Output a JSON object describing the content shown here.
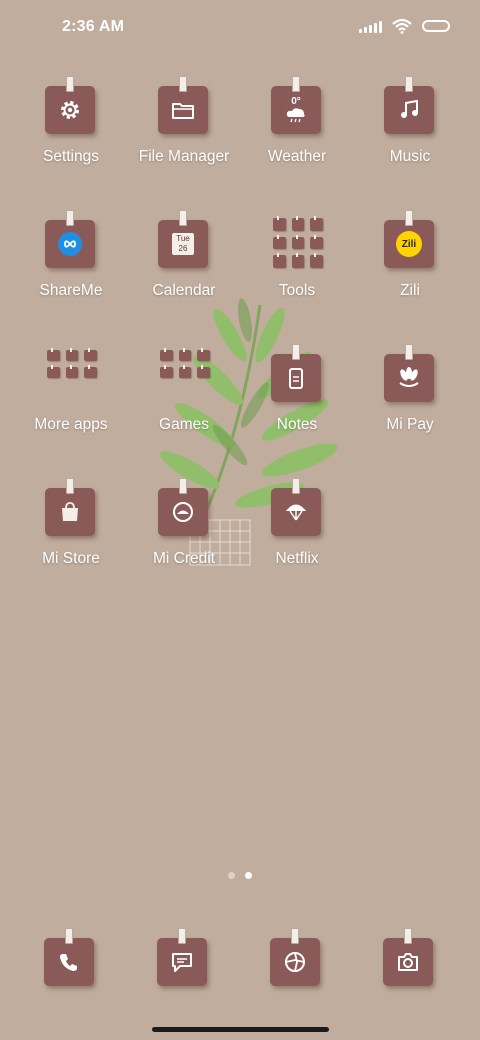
{
  "status_bar": {
    "time": "2:36 AM",
    "icons": [
      "signal-icon",
      "wifi-icon",
      "battery-icon"
    ]
  },
  "apps": [
    {
      "label": "Settings",
      "icon": "gear-icon"
    },
    {
      "label": "File Manager",
      "icon": "folder-icon"
    },
    {
      "label": "Weather",
      "icon": "cloud-rain-icon",
      "badge": "0°"
    },
    {
      "label": "Music",
      "icon": "music-note-icon"
    },
    {
      "label": "ShareMe",
      "icon": "infinity-icon"
    },
    {
      "label": "Calendar",
      "icon": "calendar-icon",
      "day": "Tue",
      "date": "26"
    },
    {
      "label": "Tools",
      "icon": "folder-grid-icon"
    },
    {
      "label": "Zili",
      "icon": "zili-logo",
      "logo_text": "Zili"
    },
    {
      "label": "More apps",
      "icon": "folder-grid-icon"
    },
    {
      "label": "Games",
      "icon": "folder-grid-icon"
    },
    {
      "label": "Notes",
      "icon": "note-icon"
    },
    {
      "label": "Mi Pay",
      "icon": "mi-pay-icon"
    },
    {
      "label": "Mi Store",
      "icon": "shopping-bag-icon"
    },
    {
      "label": "Mi Credit",
      "icon": "credit-icon"
    },
    {
      "label": "Netflix",
      "icon": "umbrella-icon"
    }
  ],
  "page_indicator": {
    "pages": 2,
    "active_page": 2
  },
  "dock": [
    {
      "name": "phone",
      "icon": "phone-icon"
    },
    {
      "name": "messages",
      "icon": "message-icon"
    },
    {
      "name": "browser",
      "icon": "browser-icon"
    },
    {
      "name": "camera",
      "icon": "camera-icon"
    }
  ],
  "colors": {
    "wallpaper": "#c1ad9d",
    "tile": "#8a5a58",
    "label": "#ffffff"
  }
}
